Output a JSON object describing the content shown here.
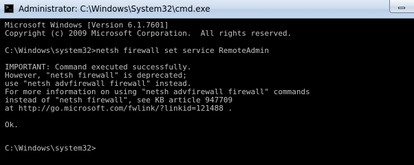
{
  "window": {
    "title": "Administrator: C:\\Windows\\System32\\cmd.exe",
    "icon": "cmd-icon",
    "controls": [
      "minimize-icon"
    ]
  },
  "console": {
    "line_01": "Microsoft Windows [Version 6.1.7601]",
    "line_02": "Copyright (c) 2009 Microsoft Corporation.  All rights reserved.",
    "line_03": "",
    "line_04": "C:\\Windows\\system32>netsh firewall set service RemoteAdmin",
    "line_05": "",
    "line_06": "IMPORTANT: Command executed successfully.",
    "line_07": "However, \"netsh firewall\" is deprecated;",
    "line_08": "use \"netsh advfirewall firewall\" instead.",
    "line_09": "For more information on using \"netsh advfirewall firewall\" commands",
    "line_10": "instead of \"netsh firewall\", see KB article 947709",
    "line_11": "at http://go.microsoft.com/fwlink/?linkid=121488 .",
    "line_12": "",
    "line_13": "Ok.",
    "line_14": "",
    "line_15": "",
    "line_16": "C:\\Windows\\system32>"
  },
  "colors": {
    "console_background": "#000000",
    "console_text": "#c0c0c0"
  }
}
